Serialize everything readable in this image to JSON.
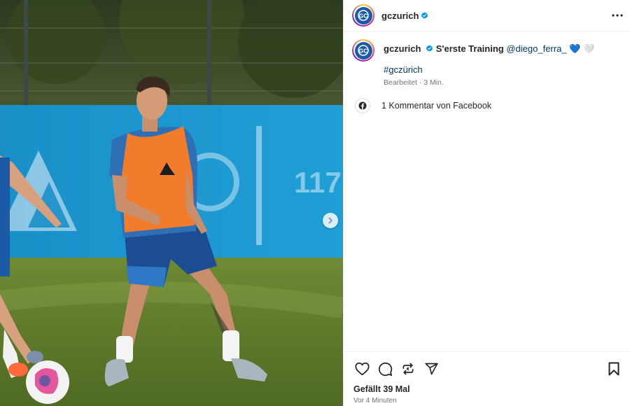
{
  "post": {
    "username": "gczurich",
    "more_icon": "more-horizontal-icon",
    "verified_icon": "verified-badge-icon",
    "caption": {
      "text": "S'erste Training",
      "mention": "@diego_ferra_",
      "emoji": "💙 🤍",
      "hashtag": "#gczürich",
      "meta": "Bearbeitet · 3 Min."
    },
    "facebook": {
      "label": "1 Kommentar von Facebook",
      "icon": "facebook-icon"
    },
    "actions": {
      "icons": [
        "heart-icon",
        "comment-icon",
        "repost-icon",
        "share-icon",
        "bookmark-icon"
      ]
    },
    "likes": "Gefällt 39 Mal",
    "timestamp": "Vor 4 Minuten"
  },
  "media": {
    "logo_text": "GC",
    "next_icon": "chevron-right-icon",
    "banner_number": "117"
  },
  "colors": {
    "link": "#00376b",
    "secondary_text": "#737373",
    "verified": "#0095f6",
    "brand_blue": "#1b5aa6"
  }
}
